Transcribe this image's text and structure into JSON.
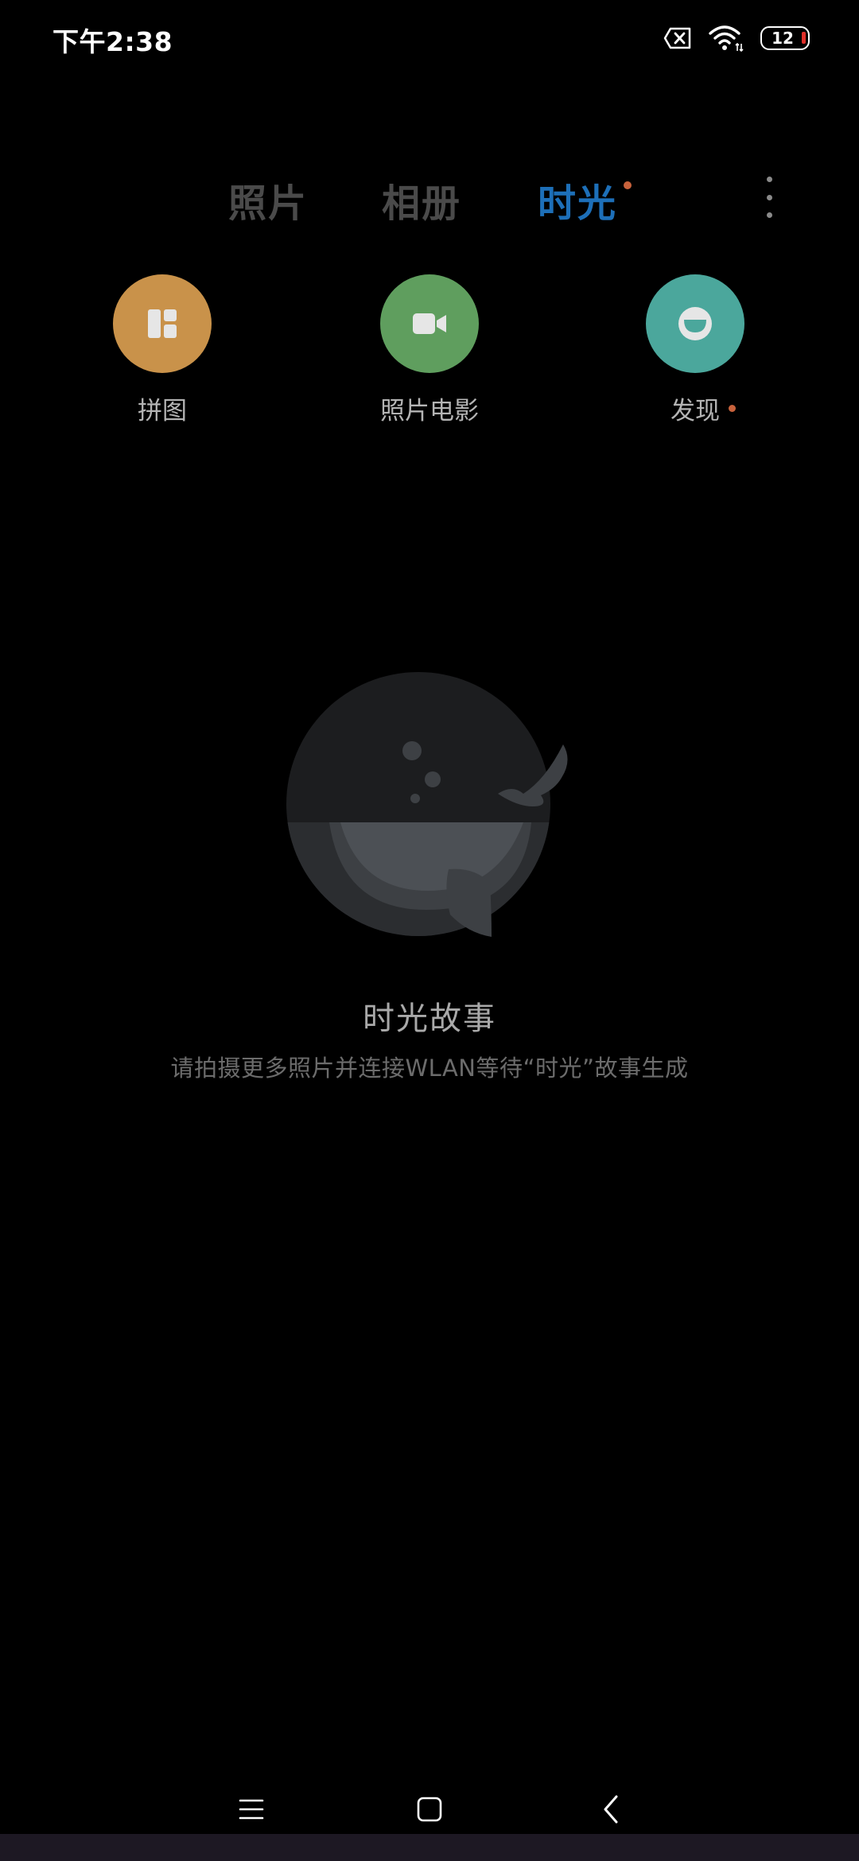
{
  "status_bar": {
    "time": "下午2:38",
    "battery_level": "12",
    "icons": [
      "sim-error-icon",
      "wifi-icon",
      "battery-icon"
    ]
  },
  "tabs": [
    {
      "label": "照片",
      "active": false
    },
    {
      "label": "相册",
      "active": false
    },
    {
      "label": "时光",
      "active": true,
      "has_dot": true
    }
  ],
  "quick_actions": [
    {
      "label": "拼图",
      "icon": "collage-icon",
      "color": "#c9924a"
    },
    {
      "label": "照片电影",
      "icon": "video-camera-icon",
      "color": "#5f9e5e"
    },
    {
      "label": "发现",
      "icon": "smiley-face-icon",
      "color": "#4ba79c",
      "has_dot": true
    }
  ],
  "empty_state": {
    "illustration": "whale-illustration",
    "title": "时光故事",
    "subtitle": "请拍摄更多照片并连接WLAN等待“时光”故事生成"
  },
  "nav_bar": {
    "icons": [
      "menu-icon",
      "home-square-icon",
      "back-arrow-icon"
    ]
  },
  "colors": {
    "background": "#000000",
    "accent": "#1d6fb8",
    "notification_dot": "#c8623c",
    "battery_low": "#e0302a",
    "inactive_tab": "#4a4a4a"
  }
}
